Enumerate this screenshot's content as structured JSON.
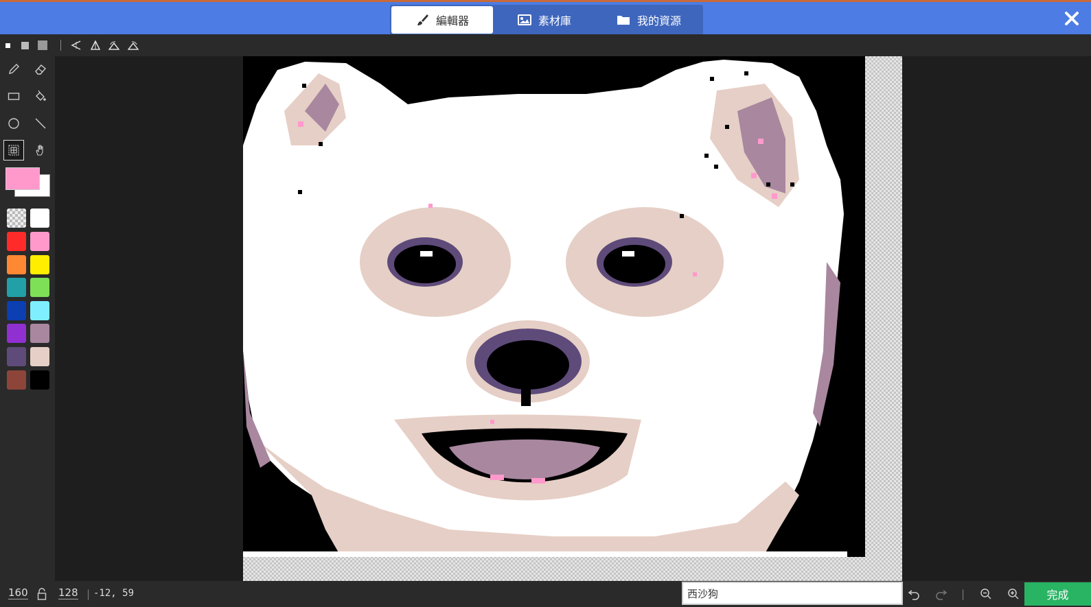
{
  "header": {
    "tabs": [
      {
        "label": "編輯器",
        "icon": "paintbrush-icon",
        "active": true
      },
      {
        "label": "素材庫",
        "icon": "image-icon",
        "active": false
      },
      {
        "label": "我的資源",
        "icon": "folder-icon",
        "active": false
      }
    ],
    "close_icon": "close-icon"
  },
  "toolbar": {
    "brush_sizes": [
      "small",
      "medium",
      "large"
    ],
    "transforms": [
      "flip-horizontal-icon",
      "flip-vertical-icon",
      "rotate-left-icon",
      "rotate-right-icon"
    ]
  },
  "tools": [
    {
      "name": "pencil-icon"
    },
    {
      "name": "eraser-icon"
    },
    {
      "name": "rectangle-icon"
    },
    {
      "name": "fill-bucket-icon"
    },
    {
      "name": "circle-icon"
    },
    {
      "name": "line-icon"
    },
    {
      "name": "select-icon",
      "active": true
    },
    {
      "name": "pan-hand-icon"
    }
  ],
  "colors": {
    "primary": "#ff99cc",
    "secondary": "#ffffff",
    "palette": [
      "transparent",
      "#ffffff",
      "#ff2a2a",
      "#ff99cc",
      "#ff8833",
      "#ffee00",
      "#22a0a8",
      "#7ee057",
      "#0b3fb2",
      "#7fefff",
      "#9030d0",
      "#a8879f",
      "#5e4b7a",
      "#e6cfc6",
      "#8e4539",
      "#000000"
    ]
  },
  "status": {
    "width": "160",
    "height": "128",
    "cursor": "-12, 59",
    "sprite_name": "西沙狗",
    "done_label": "完成"
  }
}
